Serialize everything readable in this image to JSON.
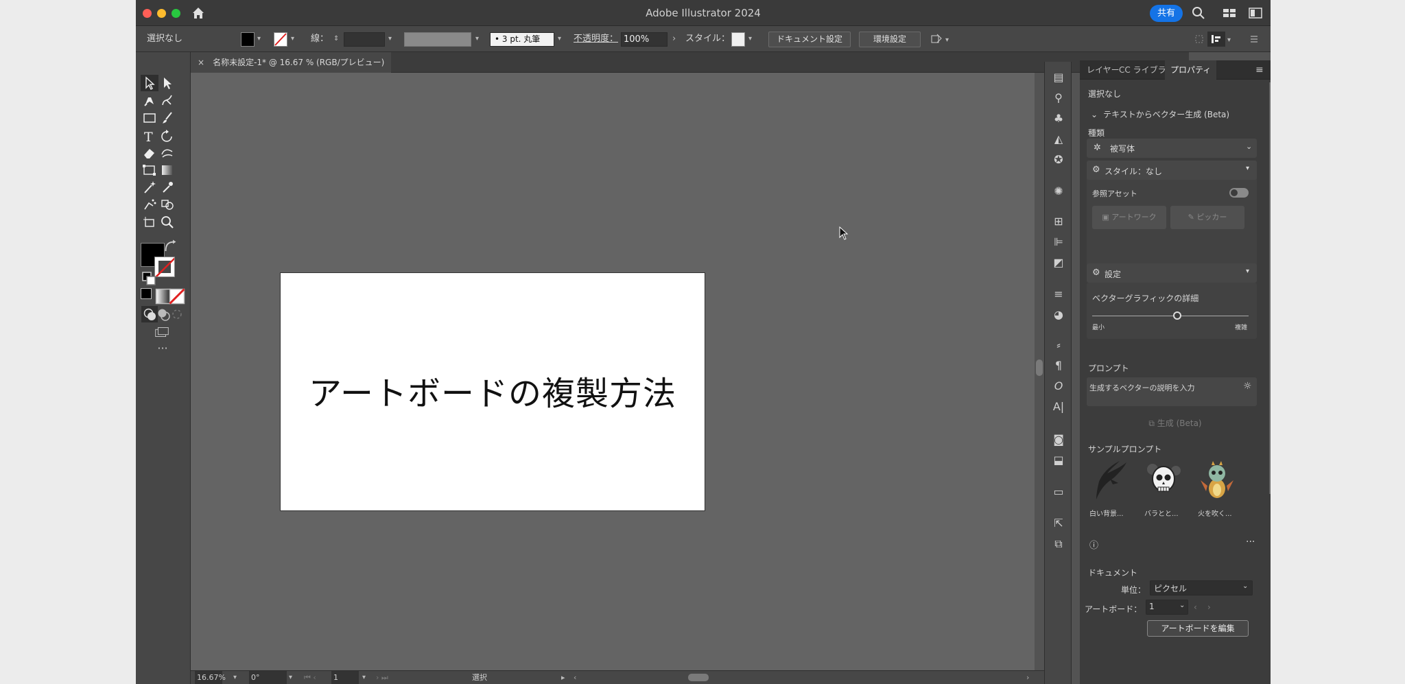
{
  "window": {
    "title": "Adobe Illustrator 2024",
    "share_label": "共有"
  },
  "control_bar": {
    "selection": "選択なし",
    "stroke_label": "線：",
    "brush": "3 pt. 丸筆",
    "opacity_label": "不透明度：",
    "opacity_value": "100%",
    "style_label": "スタイル：",
    "doc_settings": "ドキュメント設定",
    "preferences": "環境設定"
  },
  "document_tab": {
    "close": "×",
    "title": "名称未設定-1* @ 16.67 % (RGB/プレビュー)"
  },
  "artboard": {
    "text": "アートボードの複製方法"
  },
  "status_bar": {
    "zoom": "16.67%",
    "rotation": "0°",
    "artboard_num": "1",
    "tool": "選択"
  },
  "panel": {
    "tabs": [
      "レイヤー",
      "CC ライブラリ",
      "プロパティ"
    ],
    "no_selection": "選択なし",
    "text_to_vector": "テキストからベクター生成 (Beta)",
    "type_label": "種類",
    "type_value": "被写体",
    "style_label": "スタイル：なし",
    "ref_asset": "参照アセット",
    "artwork_btn": "アートワーク",
    "picker_btn": "ピッカー",
    "settings_label": "設定",
    "detail_label": "ベクターグラフィックの詳細",
    "detail_min": "最小",
    "detail_max": "複雑",
    "detail_level": 0.55,
    "prompt_label": "プロンプト",
    "prompt_placeholder": "生成するベクターの説明を入力",
    "generate_btn": "生成 (Beta)",
    "samples_label": "サンプルプロンプト",
    "samples": [
      "白い背景...",
      "バラとと...",
      "火を吹く..."
    ],
    "document_label": "ドキュメント",
    "units_label": "単位：",
    "units_value": "ピクセル",
    "artboard_label": "アートボード：",
    "artboard_value": "1",
    "edit_artboards": "アートボードを編集"
  }
}
